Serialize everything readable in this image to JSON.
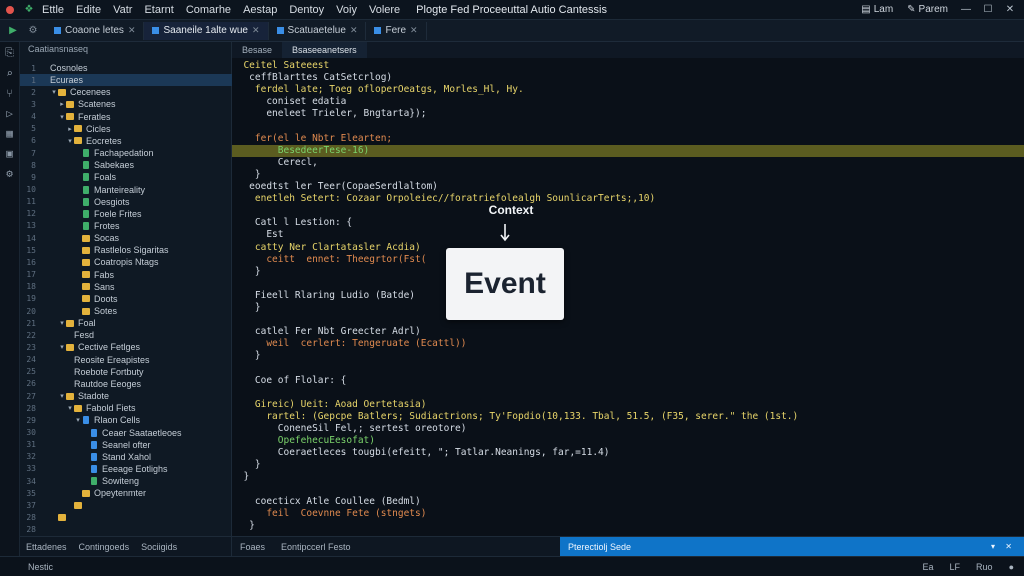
{
  "menubar": {
    "items": [
      "Ettle",
      "Edite",
      "Vatr",
      "Etarnt",
      "Comarhe",
      "Aestap",
      "Dentoy",
      "Voiy",
      "Volere"
    ],
    "app_title": "Plogte Fed Proceeuttal Autio Cantessis",
    "right_button_1": "Lam",
    "right_button_2": "Parem"
  },
  "toolbar": {
    "tabs": [
      {
        "label": "Coaone letes"
      },
      {
        "label": "Saaneile 1alte wue"
      },
      {
        "label": "Scatuaetelue"
      },
      {
        "label": "Fere"
      }
    ]
  },
  "sidebar": {
    "header": "Caatiansnaseq",
    "rows": [
      {
        "n": "1",
        "label": "Cosnoles",
        "depth": 0,
        "chev": "",
        "icon": "none"
      },
      {
        "n": "1",
        "label": "Ecuraes",
        "depth": 0,
        "chev": "",
        "icon": "none",
        "selected": true
      },
      {
        "n": "2",
        "label": "Cecenees",
        "depth": 1,
        "chev": "▾",
        "icon": "folder"
      },
      {
        "n": "3",
        "label": "Scatenes",
        "depth": 2,
        "chev": "▸",
        "icon": "folder"
      },
      {
        "n": "4",
        "label": "Feratles",
        "depth": 2,
        "chev": "▾",
        "icon": "folder"
      },
      {
        "n": "5",
        "label": "Cicles",
        "depth": 3,
        "chev": "▸",
        "icon": "folder"
      },
      {
        "n": "6",
        "label": "Eocretes",
        "depth": 3,
        "chev": "▾",
        "icon": "folder"
      },
      {
        "n": "7",
        "label": "Fachapedation",
        "depth": 4,
        "chev": "",
        "icon": "file"
      },
      {
        "n": "8",
        "label": "Sabekaes",
        "depth": 4,
        "chev": "",
        "icon": "file"
      },
      {
        "n": "9",
        "label": "Foals",
        "depth": 4,
        "chev": "",
        "icon": "file"
      },
      {
        "n": "10",
        "label": "Manteireality",
        "depth": 4,
        "chev": "",
        "icon": "file"
      },
      {
        "n": "11",
        "label": "Oesgiots",
        "depth": 4,
        "chev": "",
        "icon": "file"
      },
      {
        "n": "12",
        "label": "Foele Frites",
        "depth": 4,
        "chev": "",
        "icon": "file"
      },
      {
        "n": "13",
        "label": "Frotes",
        "depth": 4,
        "chev": "",
        "icon": "file"
      },
      {
        "n": "14",
        "label": "Socas",
        "depth": 4,
        "chev": "",
        "icon": "folder"
      },
      {
        "n": "15",
        "label": "Rastlelos Sigaritas",
        "depth": 4,
        "chev": "",
        "icon": "folder"
      },
      {
        "n": "16",
        "label": "Coatropis Ntags",
        "depth": 4,
        "chev": "",
        "icon": "folder"
      },
      {
        "n": "17",
        "label": "Fabs",
        "depth": 4,
        "chev": "",
        "icon": "folder"
      },
      {
        "n": "18",
        "label": "Sans",
        "depth": 4,
        "chev": "",
        "icon": "folder"
      },
      {
        "n": "19",
        "label": "Doots",
        "depth": 4,
        "chev": "",
        "icon": "folder"
      },
      {
        "n": "20",
        "label": "Sotes",
        "depth": 4,
        "chev": "",
        "icon": "folder"
      },
      {
        "n": "21",
        "label": "Foal",
        "depth": 2,
        "chev": "▾",
        "icon": "folder"
      },
      {
        "n": "22",
        "label": "Fesd",
        "depth": 3,
        "chev": "",
        "icon": "none"
      },
      {
        "n": "23",
        "label": "Cective Fetlges",
        "depth": 2,
        "chev": "▾",
        "icon": "folder"
      },
      {
        "n": "24",
        "label": "Reosite Ereapistes",
        "depth": 3,
        "chev": "",
        "icon": "none"
      },
      {
        "n": "25",
        "label": "Roebote Fortbuty",
        "depth": 3,
        "chev": "",
        "icon": "none"
      },
      {
        "n": "26",
        "label": "Rautdoe Eeoges",
        "depth": 3,
        "chev": "",
        "icon": "none"
      },
      {
        "n": "27",
        "label": "Stadote",
        "depth": 2,
        "chev": "▾",
        "icon": "folder"
      },
      {
        "n": "28",
        "label": "Fabold Fiets",
        "depth": 3,
        "chev": "▾",
        "icon": "folder"
      },
      {
        "n": "29",
        "label": "Rlaon Cells",
        "depth": 4,
        "chev": "▾",
        "icon": "blue"
      },
      {
        "n": "30",
        "label": "Ceaer Saataetleoes",
        "depth": 5,
        "chev": "",
        "icon": "blue"
      },
      {
        "n": "31",
        "label": "Seanel ofter",
        "depth": 5,
        "chev": "",
        "icon": "blue"
      },
      {
        "n": "32",
        "label": "Stand Xahol",
        "depth": 5,
        "chev": "",
        "icon": "blue"
      },
      {
        "n": "33",
        "label": "Eeeage Eotlighs",
        "depth": 5,
        "chev": "",
        "icon": "blue"
      },
      {
        "n": "34",
        "label": "Sowiteng",
        "depth": 5,
        "chev": "",
        "icon": "file"
      },
      {
        "n": "35",
        "label": "Opeytenmter",
        "depth": 4,
        "chev": "",
        "icon": "folder"
      },
      {
        "n": "37",
        "label": "",
        "depth": 3,
        "chev": "",
        "icon": "folder"
      },
      {
        "n": "28",
        "label": "",
        "depth": 1,
        "chev": "",
        "icon": "folder"
      },
      {
        "n": "28",
        "label": "",
        "depth": 0,
        "chev": "",
        "icon": "none"
      }
    ],
    "footer": [
      "Ettadenes",
      "Contingoeds",
      "Sociigids"
    ]
  },
  "editor": {
    "tabs": [
      "Besase",
      "Bsaseeanetsers"
    ],
    "lines": [
      {
        "t": "  Ceitel Sateeest",
        "c": "kw"
      },
      {
        "t": "   ceffBlarttes CatSetcrlog)",
        "c": "id"
      },
      {
        "t": "    ferdel late; Toeg ofloperOeatgs, Morles_Hl, Hy.",
        "c": "kw"
      },
      {
        "t": "      coniset edatia",
        "c": "id"
      },
      {
        "t": "      eneleet Trieler, Bngtarta});",
        "c": "id"
      },
      {
        "t": "",
        "c": "id"
      },
      {
        "t": "    fer(el le Nbtr Elearten;",
        "c": "fn"
      },
      {
        "t": "        BesedeerTese-16)",
        "c": "str",
        "hl": true
      },
      {
        "t": "        Cerecl,",
        "c": "id"
      },
      {
        "t": "    }",
        "c": "id"
      },
      {
        "t": "   eoedtst ler Teer(CopaeSerdlaltom)",
        "c": "id"
      },
      {
        "t": "    enetleh Setert: Cozaar Orpoleiec//foratriefolealgh SounlicarTerts;,10)",
        "c": "kw"
      },
      {
        "t": "",
        "c": "id"
      },
      {
        "t": "    Catl l Lestion: {",
        "c": "id"
      },
      {
        "t": "      Est",
        "c": "id"
      },
      {
        "t": "    catty Ner Clartatasler Acdia)",
        "c": "kw"
      },
      {
        "t": "      ceitt  ennet: Theegrtor(Fst(           ];",
        "c": "fn"
      },
      {
        "t": "    }",
        "c": "id"
      },
      {
        "t": "",
        "c": "id"
      },
      {
        "t": "    Fieell Rlaring Ludio (Batde)",
        "c": "id"
      },
      {
        "t": "    }",
        "c": "id"
      },
      {
        "t": "",
        "c": "id"
      },
      {
        "t": "    catlel Fer Nbt Greecter Adrl)",
        "c": "id"
      },
      {
        "t": "      weil  cerlert: Tengeruate (Ecattl))",
        "c": "fn"
      },
      {
        "t": "    }",
        "c": "id"
      },
      {
        "t": "",
        "c": "id"
      },
      {
        "t": "    Coe of Flolar: {",
        "c": "id"
      },
      {
        "t": "",
        "c": "id"
      },
      {
        "t": "    Gireic) Ueit: Aoad Oertetasia)",
        "c": "kw"
      },
      {
        "t": "      rartel: (Gepcpe Batlers; Sudiactrions; Ty'Fopdio(10,133. Tbal, 51.5, (F35, serer.\" the (1st.)",
        "c": "kw"
      },
      {
        "t": "        ConeneSil Fel,; sertest oreotore)",
        "c": "id"
      },
      {
        "t": "        OpefehecuEesofat)",
        "c": "str"
      },
      {
        "t": "        Coeraetleces tougbi(efeitt, \"; Tatlar.Neanings, far,=11.4)",
        "c": "id"
      },
      {
        "t": "    }",
        "c": "id"
      },
      {
        "t": "  }",
        "c": "id"
      },
      {
        "t": "",
        "c": "id"
      },
      {
        "t": "    coecticx Atle Coullee (Bedml)",
        "c": "id"
      },
      {
        "t": "      feil  Coevnne Fete (stngets)",
        "c": "fn"
      },
      {
        "t": "   }",
        "c": "id"
      }
    ]
  },
  "overlay": {
    "context_label": "Context",
    "event_label": "Event"
  },
  "panel": {
    "tabs": [
      "Foaes",
      "Eontipccerl Festo"
    ],
    "active_tab": "Pterectiolj Sede",
    "active_color": "#0f74c8"
  },
  "statusbar": {
    "left": "Nestic",
    "right": [
      "Ea",
      "LF",
      "Ruo",
      "●"
    ]
  },
  "colors": {
    "highlight_line": "#5b5c20",
    "selection": "#1b3856",
    "folder": "#e3b23c"
  }
}
